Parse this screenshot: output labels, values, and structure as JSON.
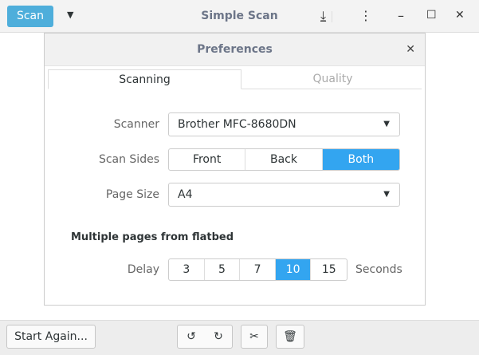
{
  "header": {
    "scan_label": "Scan",
    "title": "Simple Scan"
  },
  "dialog": {
    "title": "Preferences",
    "tabs": [
      "Scanning",
      "Quality"
    ],
    "scanner_label": "Scanner",
    "scanner_value": "Brother MFC-8680DN",
    "sides_label": "Scan Sides",
    "sides": [
      "Front",
      "Back",
      "Both"
    ],
    "sides_selected": "Both",
    "page_size_label": "Page Size",
    "page_size_value": "A4",
    "flatbed_heading": "Multiple pages from flatbed",
    "delay_label": "Delay",
    "delays": [
      "3",
      "5",
      "7",
      "10",
      "15"
    ],
    "delay_selected": "10",
    "seconds_label": "Seconds"
  },
  "footer": {
    "start_again": "Start Again..."
  }
}
